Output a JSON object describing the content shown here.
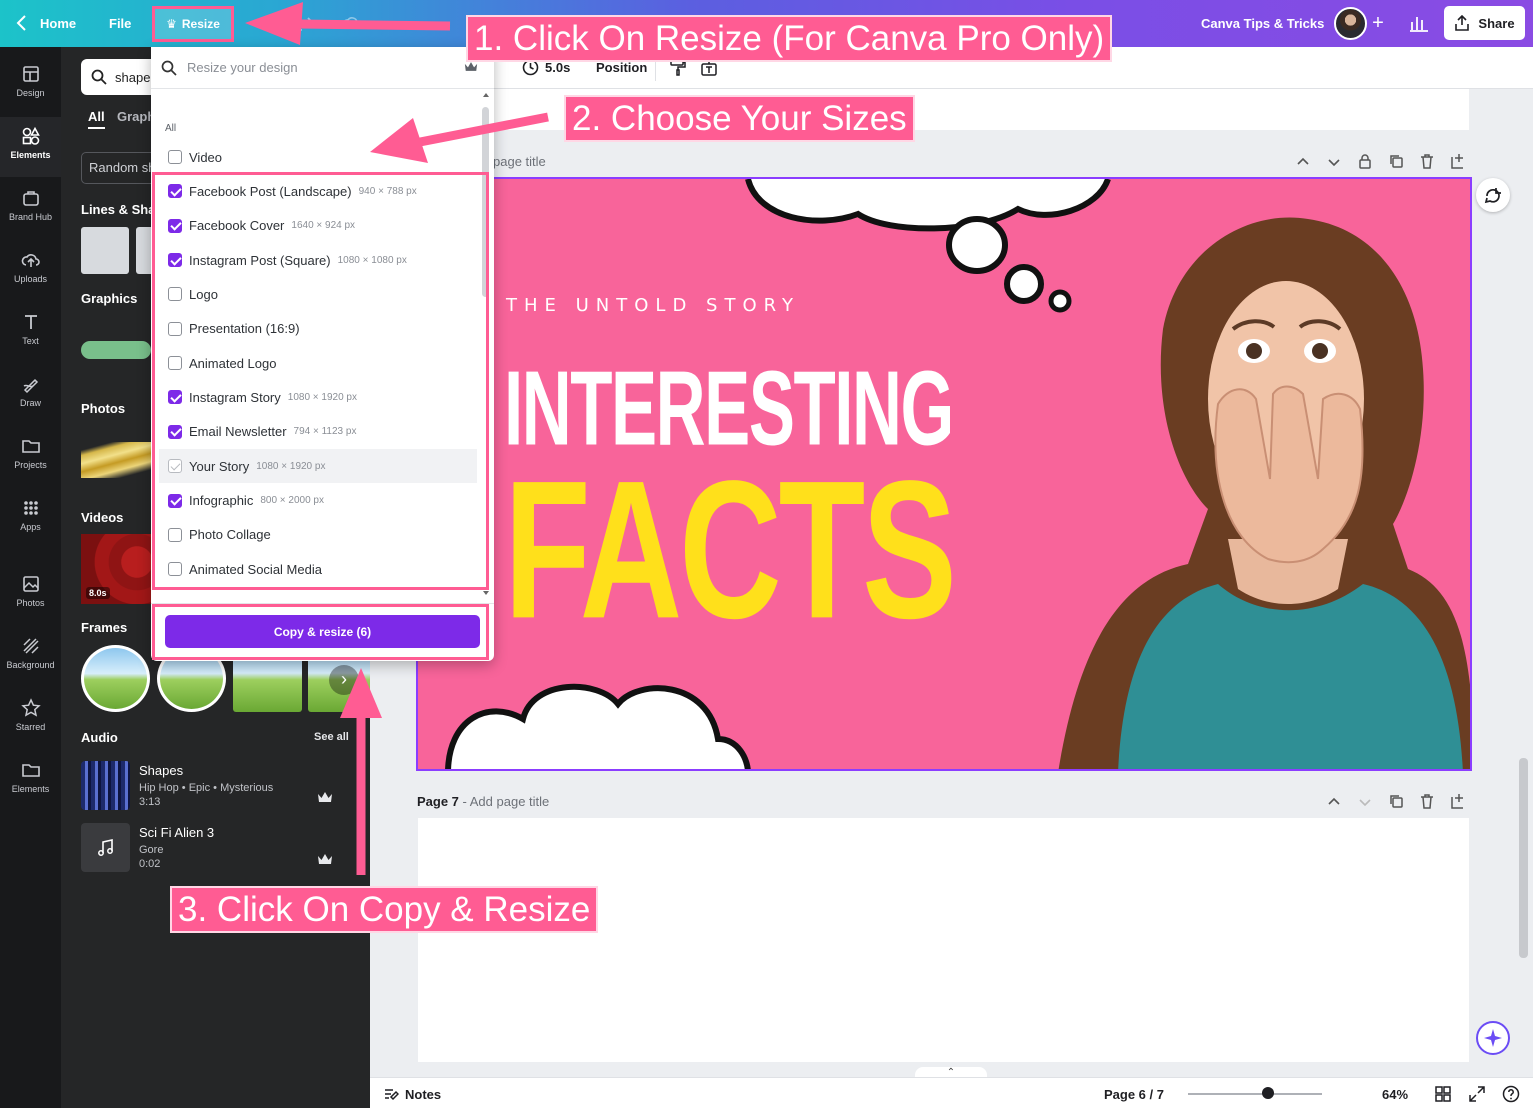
{
  "topbar": {
    "home": "Home",
    "file": "File",
    "resize": "Resize",
    "brand_kit": "Canva Tips & Tricks",
    "share": "Share"
  },
  "rail": [
    {
      "label": "Design",
      "icon": "layout-icon"
    },
    {
      "label": "Elements",
      "icon": "shapes-icon",
      "active": true
    },
    {
      "label": "Brand Hub",
      "icon": "brand-hub-icon"
    },
    {
      "label": "Uploads",
      "icon": "upload-cloud-icon"
    },
    {
      "label": "Text",
      "icon": "text-icon"
    },
    {
      "label": "Draw",
      "icon": "draw-icon"
    },
    {
      "label": "Projects",
      "icon": "folder-icon"
    },
    {
      "label": "Apps",
      "icon": "apps-grid-icon"
    },
    {
      "label": "Photos",
      "icon": "photo-icon"
    },
    {
      "label": "Background",
      "icon": "background-icon"
    },
    {
      "label": "Starred",
      "icon": "star-icon"
    },
    {
      "label": "Elements",
      "icon": "folder-icon"
    }
  ],
  "panel": {
    "search_value": "shape",
    "tab_all": "All",
    "tab_graphics": "Graph",
    "random_pill": "Random sh",
    "lines_shapes": "Lines & Shap",
    "graphics": "Graphics",
    "photos": "Photos",
    "videos": "Videos",
    "video_duration": "8.0s",
    "frames": "Frames",
    "audio": "Audio",
    "see_all": "See all",
    "tracks": [
      {
        "title": "Shapes",
        "meta": "Hip Hop • Epic • Mysterious",
        "time": "3:13"
      },
      {
        "title": "Sci Fi Alien 3",
        "meta": "Gore",
        "time": "0:02"
      }
    ]
  },
  "toolbar": {
    "duration": "5.0s",
    "position": "Position"
  },
  "resize_menu": {
    "placeholder": "Resize your design",
    "section_label": "All",
    "options": [
      {
        "label": "Video",
        "dims": "",
        "checked": false
      },
      {
        "label": "Facebook Post (Landscape)",
        "dims": "940 × 788 px",
        "checked": true
      },
      {
        "label": "Facebook Cover",
        "dims": "1640 × 924 px",
        "checked": true
      },
      {
        "label": "Instagram Post (Square)",
        "dims": "1080 × 1080 px",
        "checked": true
      },
      {
        "label": "Logo",
        "dims": "",
        "checked": false
      },
      {
        "label": "Presentation (16:9)",
        "dims": "",
        "checked": false
      },
      {
        "label": "Animated Logo",
        "dims": "",
        "checked": false
      },
      {
        "label": "Instagram Story",
        "dims": "1080 × 1920 px",
        "checked": true
      },
      {
        "label": "Email Newsletter",
        "dims": "794 × 1123 px",
        "checked": true
      },
      {
        "label": "Your Story",
        "dims": "1080 × 1920 px",
        "checked": "disabled"
      },
      {
        "label": "Infographic",
        "dims": "800 × 2000 px",
        "checked": true
      },
      {
        "label": "Photo Collage",
        "dims": "",
        "checked": false
      },
      {
        "label": "Animated Social Media",
        "dims": "",
        "checked": false
      }
    ],
    "copy_button": "Copy & resize (6)"
  },
  "canvas": {
    "page6_title": "page title",
    "design_kicker": "THE UNTOLD STORY",
    "design_line1": "INTERESTING",
    "design_line2": "FACTS",
    "page7_label": "Page 7",
    "page7_placeholder": "Add page title"
  },
  "bottom": {
    "notes": "Notes",
    "page_indicator": "Page 6 / 7",
    "zoom": "64%"
  },
  "annotations": {
    "step1": "1. Click On Resize (For Canva Pro Only)",
    "step2": "2. Choose Your Sizes",
    "step3": "3. Click On Copy & Resize"
  },
  "colors": {
    "accent_purple": "#7d2ae8",
    "annotation_pink": "#ff5c93",
    "design_pink": "#f8649a",
    "design_yellow": "#ffe01b"
  }
}
